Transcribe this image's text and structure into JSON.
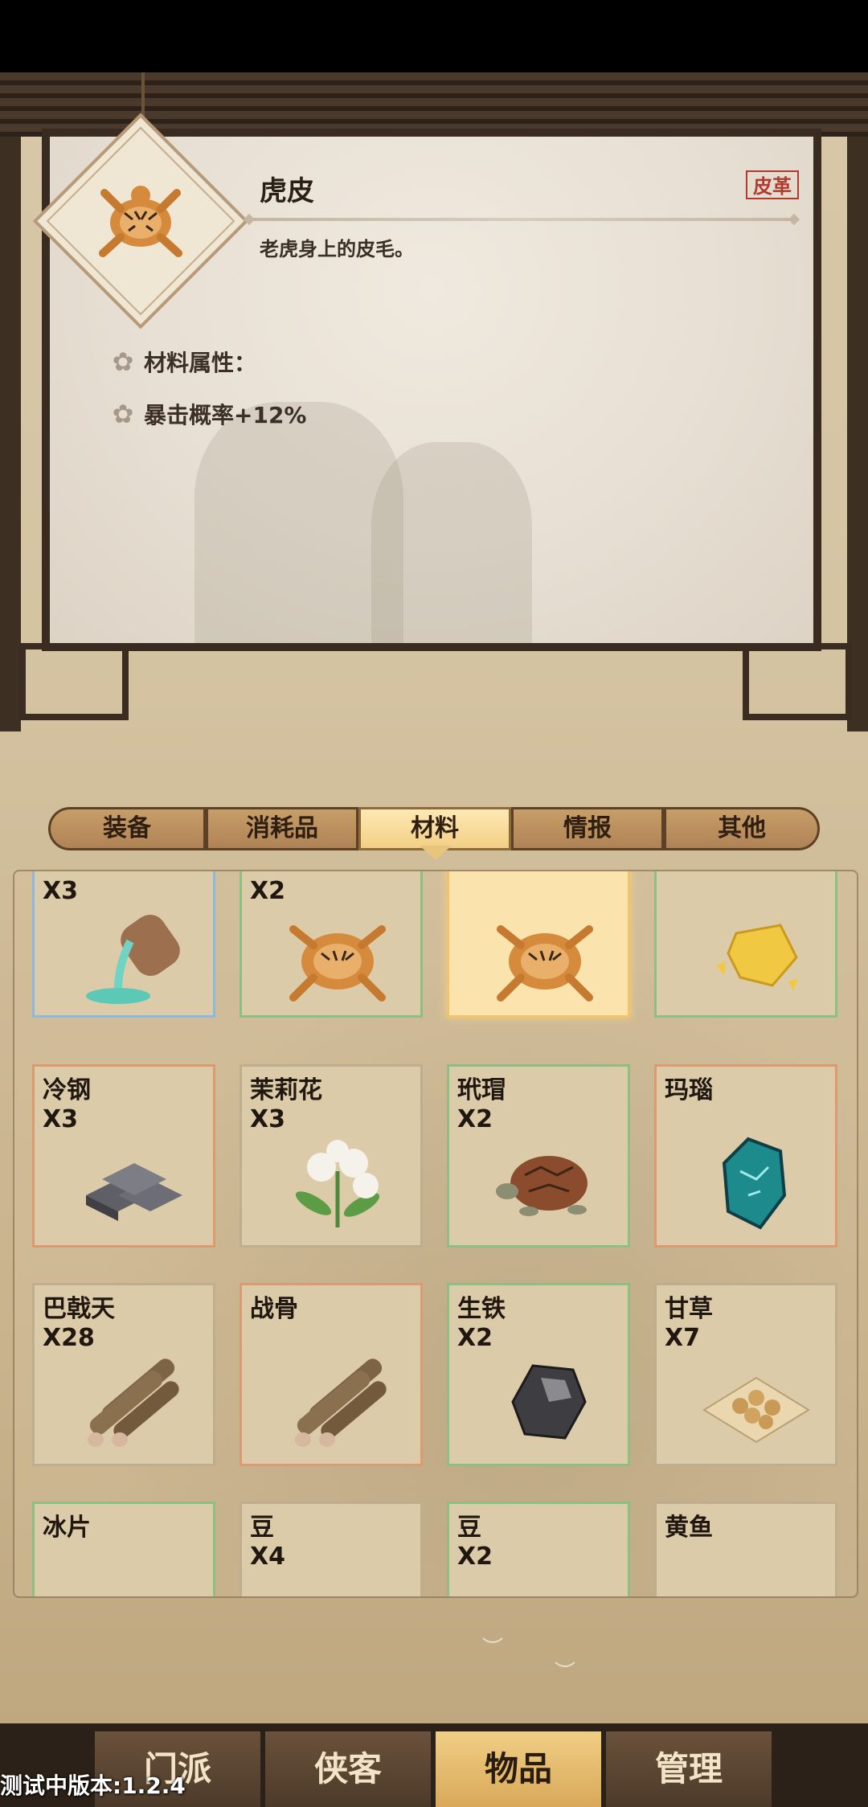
{
  "detail": {
    "name": "虎皮",
    "tag": "皮革",
    "description": "老虎身上的皮毛。",
    "attributes_title": "材料属性：",
    "attribute_1": "暴击概率+12%"
  },
  "tabs": [
    {
      "label": "装备"
    },
    {
      "label": "消耗品"
    },
    {
      "label": "材料"
    },
    {
      "label": "情报"
    },
    {
      "label": "其他"
    }
  ],
  "grid": {
    "r0": [
      {
        "name": "",
        "count": "X3"
      },
      {
        "name": "",
        "count": "X2"
      },
      {
        "name": "",
        "count": ""
      },
      {
        "name": "",
        "count": ""
      }
    ],
    "r1": [
      {
        "name": "冷钢",
        "count": "X3"
      },
      {
        "name": "茉莉花",
        "count": "X3"
      },
      {
        "name": "玳瑁",
        "count": "X2"
      },
      {
        "name": "玛瑙",
        "count": ""
      }
    ],
    "r2": [
      {
        "name": "巴戟天",
        "count": "X28"
      },
      {
        "name": "战骨",
        "count": ""
      },
      {
        "name": "生铁",
        "count": "X2"
      },
      {
        "name": "甘草",
        "count": "X7"
      }
    ],
    "r3": [
      {
        "name": "冰片",
        "count": ""
      },
      {
        "name": "豆",
        "count": "X4"
      },
      {
        "name": "豆",
        "count": "X2"
      },
      {
        "name": "黄鱼",
        "count": ""
      }
    ]
  },
  "nav": [
    {
      "label": "门派"
    },
    {
      "label": "侠客"
    },
    {
      "label": "物品"
    },
    {
      "label": "管理"
    }
  ],
  "version": "测试中版本:1.2.4",
  "colors": {
    "selected_tab": "#f3cf84",
    "nav_active": "#e3b96a",
    "rarity_blue": "#8db9dc",
    "rarity_green": "#8dbf83",
    "rarity_orange": "#dc9a72"
  }
}
